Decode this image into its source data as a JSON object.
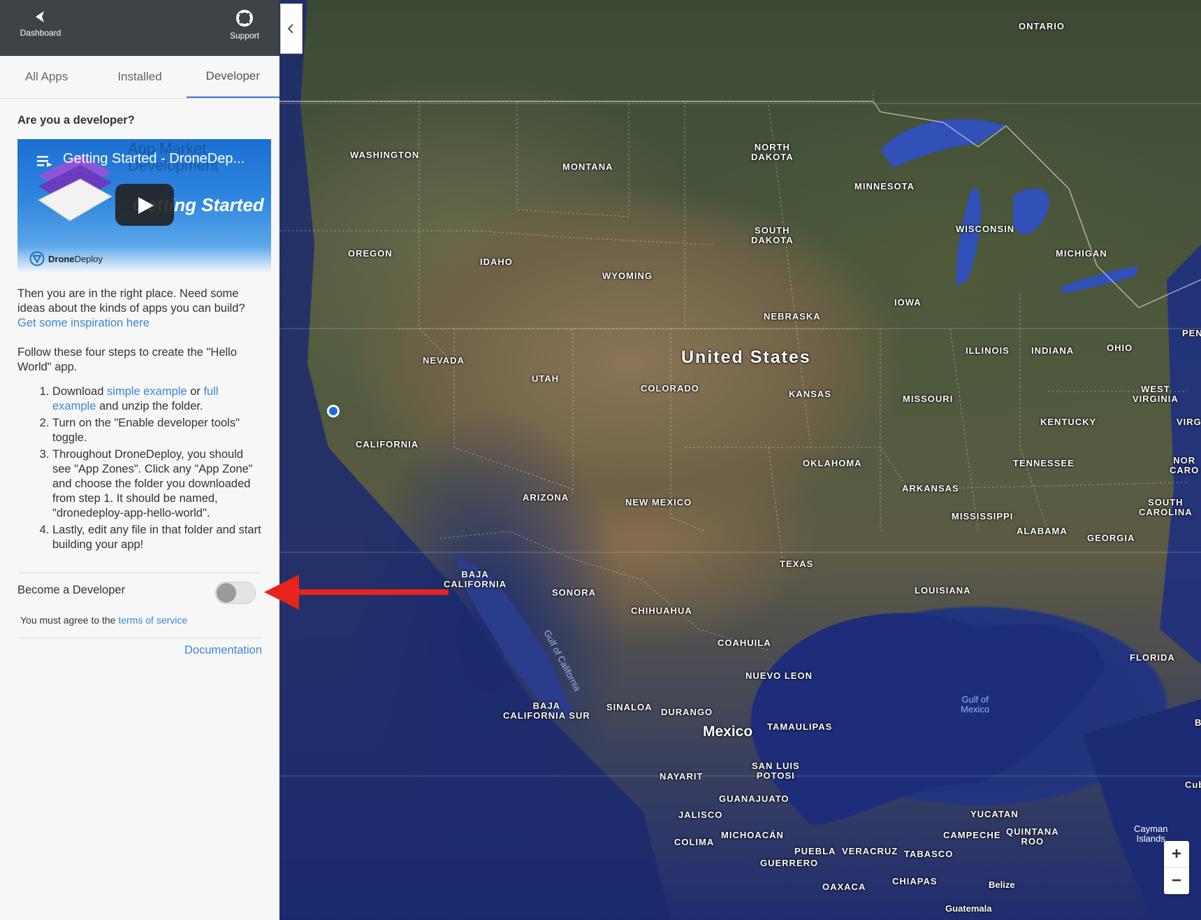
{
  "topbar": {
    "dashboard_label": "Dashboard",
    "support_label": "Support"
  },
  "tabs": [
    {
      "label": "All Apps",
      "active": false
    },
    {
      "label": "Installed",
      "active": false
    },
    {
      "label": "Developer",
      "active": true
    }
  ],
  "developer": {
    "heading": "Are you a developer?",
    "video": {
      "title": "Getting Started - DroneDep...",
      "watermark": "App Market Development",
      "overlay_text": "Getting Started",
      "logo_bold": "Drone",
      "logo_regular": "Deploy"
    },
    "intro_text": "Then you are in the right place. Need some ideas about the kinds of apps you can build?",
    "inspiration_link": "Get some inspiration here",
    "steps_intro": "Follow these four steps to create the \"Hello World\" app.",
    "steps": {
      "step1_prefix": "Download ",
      "step1_link1": "simple example",
      "step1_mid": " or ",
      "step1_link2": "full example",
      "step1_suffix": " and unzip the folder.",
      "step2": "Turn on the \"Enable developer tools\" toggle.",
      "step3": "Throughout DroneDeploy, you should see \"App Zones\". Click any \"App Zone\" and choose the folder you downloaded from step 1. It should be named, \"dronedeploy-app-hello-world\".",
      "step4": "Lastly, edit any file in that folder and start building your app!"
    },
    "become_label": "Become a Developer",
    "toggle_on": false,
    "tos_prefix": "You must agree to the ",
    "tos_link": "terms of service",
    "documentation_link": "Documentation"
  },
  "map": {
    "labels": {
      "ontario": "ONTARIO",
      "washington": "WASHINGTON",
      "montana": "MONTANA",
      "north_dakota": "NORTH\nDAKOTA",
      "minnesota": "MINNESOTA",
      "south_dakota": "SOUTH\nDAKOTA",
      "wisconsin": "WISCONSIN",
      "michigan": "MICHIGAN",
      "oregon": "OREGON",
      "idaho": "IDAHO",
      "wyoming": "WYOMING",
      "iowa": "IOWA",
      "nebraska": "NEBRASKA",
      "pen": "PEN",
      "united_states": "United States",
      "nevada": "NEVADA",
      "illinois": "ILLINOIS",
      "indiana": "INDIANA",
      "ohio": "OHIO",
      "utah": "UTAH",
      "colorado": "COLORADO",
      "kansas": "KANSAS",
      "missouri": "MISSOURI",
      "west_virginia": "WEST\nVIRGINIA",
      "kentucky": "KENTUCKY",
      "virg": "VIRG",
      "california": "CALIFORNIA",
      "oklahoma": "OKLAHOMA",
      "tennessee": "TENNESSEE",
      "nor_caro": "NOR\nCARO",
      "arkansas": "ARKANSAS",
      "arizona": "ARIZONA",
      "new_mexico": "NEW MEXICO",
      "mississippi": "MISSISSIPPI",
      "south_carolina": "SOUTH\nCAROLINA",
      "alabama": "ALABAMA",
      "georgia": "GEORGIA",
      "texas": "TEXAS",
      "baja_california": "BAJA\nCALIFORNIA",
      "sonora": "SONORA",
      "louisiana": "LOUISIANA",
      "chihuahua": "CHIHUAHUA",
      "coahuila": "COAHUILA",
      "florida": "FLORIDA",
      "gulf_of_california": "Gulf of California",
      "nuevo_leon": "NUEVO LEON",
      "gulf_of_mexico": "Gulf of\nMexico",
      "b": "B",
      "baja_california_sur": "BAJA\nCALIFORNIA SUR",
      "sinaloa": "SINALOA",
      "durango": "DURANGO",
      "mexico": "Mexico",
      "tamaulipas": "TAMAULIPAS",
      "san_luis_potosi": "SAN LUIS\nPOTOSI",
      "nayarit": "NAYARIT",
      "cub": "Cub",
      "guanajuato": "GUANAJUATO",
      "yucatan": "YUCATAN",
      "jalisco": "JALISCO",
      "campeche": "CAMPECHE",
      "quintana_roo": "QUINTANA\nROO",
      "cayman_islands": "Cayman\nIslands",
      "colima": "COLIMA",
      "michoacan": "MICHOACÁN",
      "puebla": "PUEBLA",
      "veracruz": "VERACRUZ",
      "tabasco": "TABASCO",
      "guerrero": "GUERRERO",
      "oaxaca": "OAXACA",
      "chiapas": "CHIAPAS",
      "belize": "Belize",
      "guatemala": "Guatemala"
    },
    "zoom_in": "+",
    "zoom_out": "−"
  },
  "colors": {
    "accent": "#3b87d6",
    "topbar": "#3e4347",
    "annotation_arrow": "#e8231c"
  }
}
